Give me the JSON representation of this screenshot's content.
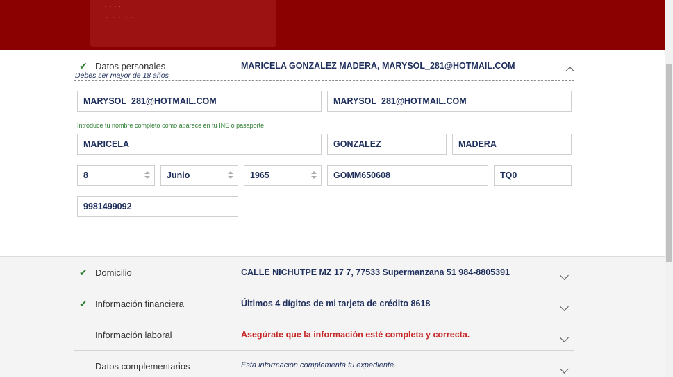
{
  "personal": {
    "title": "Datos personales",
    "summary": "MARICELA GONZALEZ MADERA, MARYSOL_281@HOTMAIL.COM",
    "age_hint": "Debes ser mayor de 18 años",
    "email": "MARYSOL_281@HOTMAIL.COM",
    "email_confirm": "MARYSOL_281@HOTMAIL.COM",
    "name_hint": "Introduce tu nombre completo como aparece en tu INE o pasaporte",
    "first_name": "MARICELA",
    "last_name": "GONZALEZ",
    "second_last_name": "MADERA",
    "birth_day": "8",
    "birth_month": "Junio",
    "birth_year": "1965",
    "rfc": "GOMM650608",
    "homoclave": "TQ0",
    "phone": "9981499092"
  },
  "sections": [
    {
      "title": "Domicilio",
      "value": "CALLE NICHUTPE MZ 17 7, 77533 Supermanzana 51 984-8805391"
    },
    {
      "title": "Información financiera",
      "value": "Últimos 4 dígitos de mi tarjeta de crédito 8618"
    },
    {
      "title": "Información laboral",
      "value": "Asegúrate que la información esté completa y correcta."
    },
    {
      "title": "Datos complementarios",
      "value": "Esta información complementa tu expediente."
    }
  ]
}
